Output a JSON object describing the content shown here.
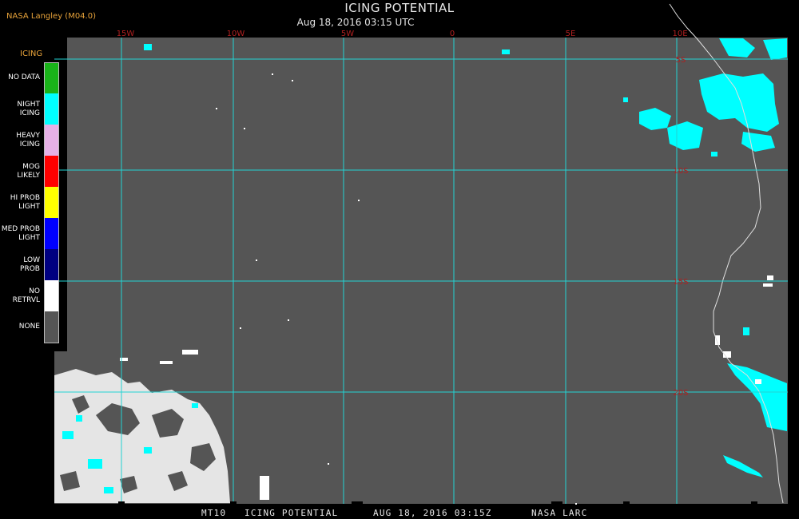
{
  "header": {
    "credit": "NASA Langley (M04.0)",
    "title": "ICING POTENTIAL",
    "subtitle": "Aug 18, 2016 03:15 UTC"
  },
  "map": {
    "background_color": "#555555",
    "grid_color": "#22d3d3",
    "label_color": "#b02020",
    "longitude_labels": [
      "15W",
      "10W",
      "5W",
      "0",
      "5E",
      "10E"
    ],
    "latitude_labels": [
      "5S",
      "10S",
      "15S",
      "20S"
    ]
  },
  "legend": {
    "title": "ICING",
    "items": [
      {
        "label": "NO DATA",
        "color": "#19b319"
      },
      {
        "label": "NIGHT\nICING",
        "color": "#00ffff"
      },
      {
        "label": "HEAVY\nICING",
        "color": "#e6b0e6"
      },
      {
        "label": "MOG\nLIKELY",
        "color": "#ff0000"
      },
      {
        "label": "HI PROB\nLIGHT",
        "color": "#ffff00"
      },
      {
        "label": "MED PROB\nLIGHT",
        "color": "#0000ff"
      },
      {
        "label": "LOW\nPROB",
        "color": "#000080"
      },
      {
        "label": "NO\nRETRVL",
        "color": "#ffffff"
      },
      {
        "label": "NONE",
        "color": "#555555"
      }
    ]
  },
  "footer": {
    "product": "MT10",
    "name": "ICING POTENTIAL",
    "time": "AUG 18, 2016 03:15Z",
    "source": "NASA LARC"
  }
}
